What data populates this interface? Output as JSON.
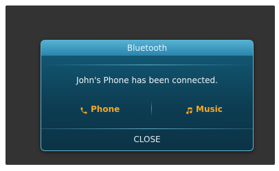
{
  "dialog": {
    "title": "Bluetooth",
    "message": "John's Phone has been connected.",
    "options": [
      {
        "label": "Phone",
        "icon": "phone-icon"
      },
      {
        "label": "Music",
        "icon": "music-note-icon"
      }
    ],
    "close_label": "CLOSE"
  },
  "colors": {
    "accent": "#f4a825",
    "header": "#3d98bd",
    "dialog_bg": "#104d66",
    "screen_bg": "#333333"
  }
}
